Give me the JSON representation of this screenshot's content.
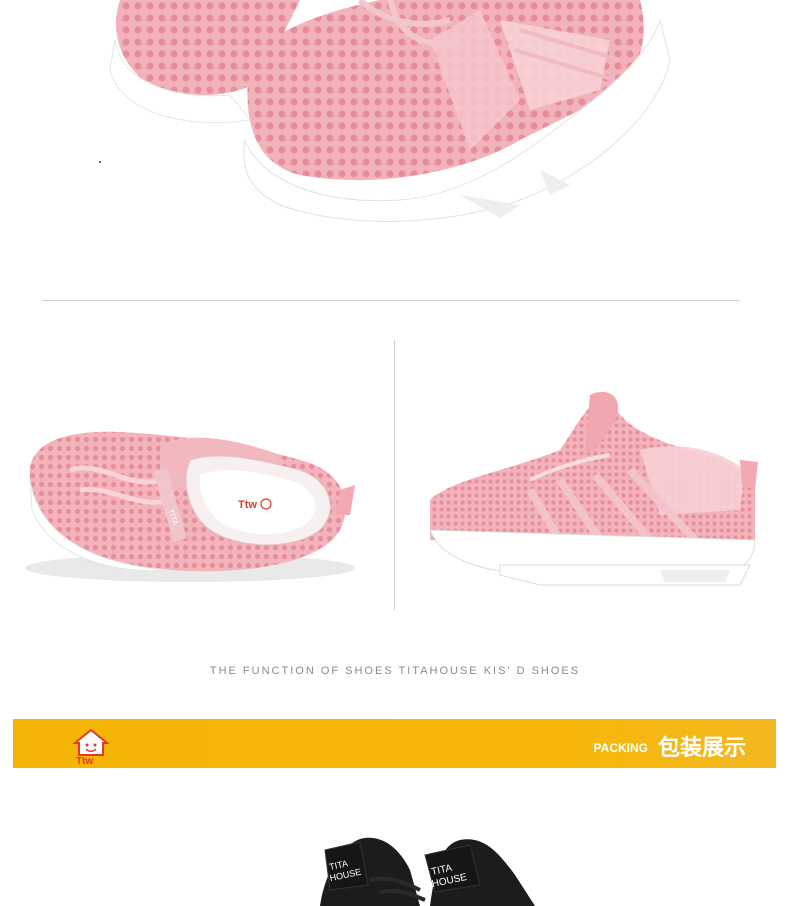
{
  "caption": "THE FUNCTION OF SHOES TITAHOUSE KIS' D SHOES",
  "banner": {
    "label_en": "PACKING",
    "label_cn": "包装展示",
    "brand_logo_text": "Ttw",
    "color": "#f6b406"
  },
  "insole_logo_text": "Ttw",
  "tongue_text": "TITA",
  "box_tongue_left": "TITA\nHOUSE",
  "box_tongue_right": "TITA\nHOUSE",
  "colors": {
    "shoe_pink": "#f2a9b2",
    "sole": "#ffffff",
    "black_shoe": "#1a1a1a"
  }
}
